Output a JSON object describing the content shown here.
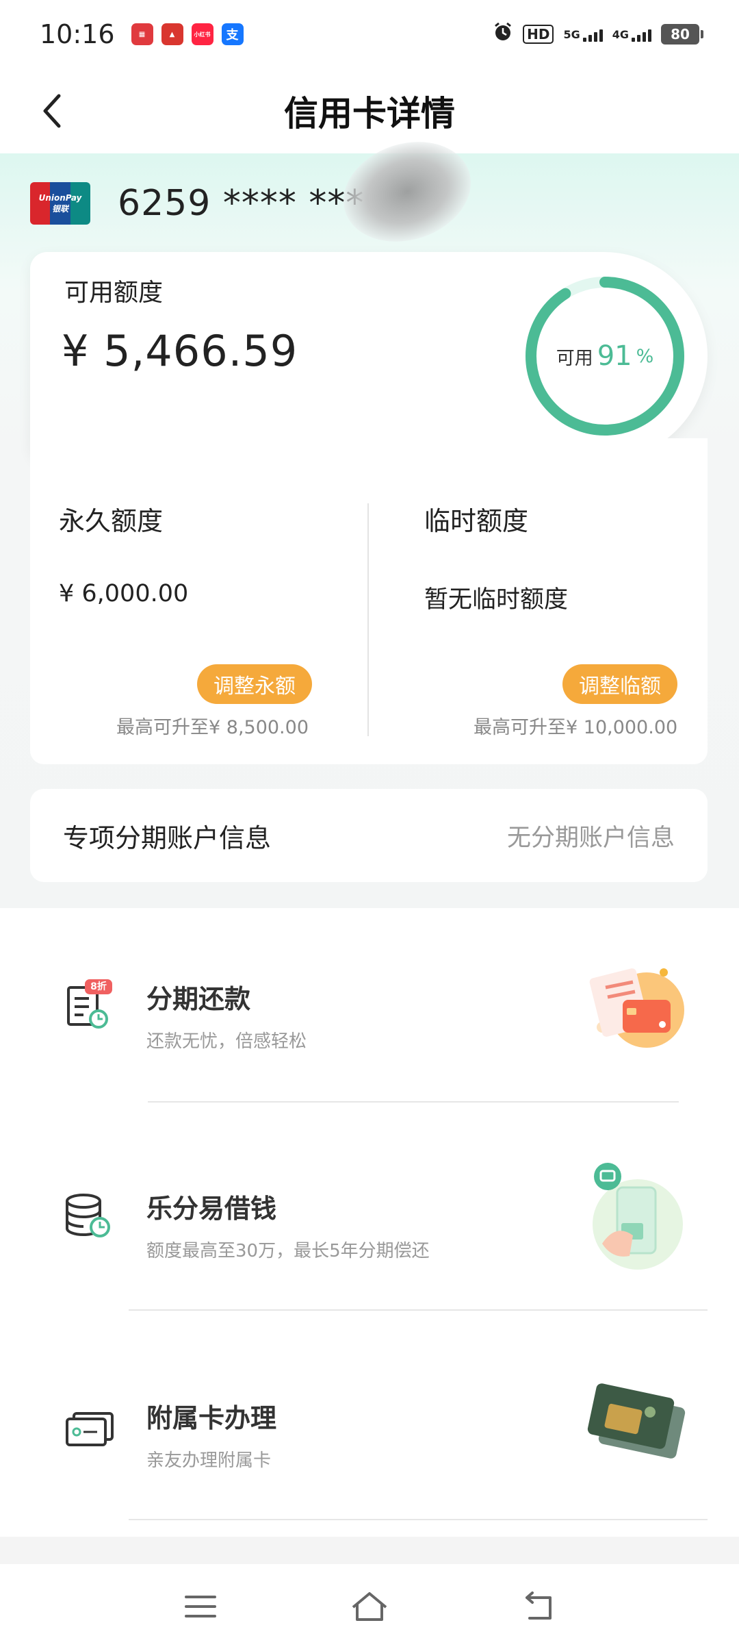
{
  "status_bar": {
    "time": "10:16",
    "app_icons": [
      {
        "name": "app-icon-red-1",
        "label": "",
        "color": "#e03a3e"
      },
      {
        "name": "app-icon-red-2",
        "label": "",
        "color": "#d9362f"
      },
      {
        "name": "app-icon-xiaohongshu",
        "label": "小红书",
        "color": "#ff2442"
      },
      {
        "name": "app-icon-alipay",
        "label": "支",
        "color": "#1677ff"
      }
    ],
    "hd_label": "HD",
    "network_5g": "5G",
    "network_4g": "4G",
    "battery": "80"
  },
  "header": {
    "title": "信用卡详情"
  },
  "card": {
    "logo_text_top": "UnionPay",
    "logo_text_bottom": "银联",
    "number_masked": "6259 **** ***"
  },
  "available": {
    "label": "可用额度",
    "amount": "¥ 5,466.59",
    "ring_label": "可用",
    "ring_percent": "91",
    "ring_unit": "%",
    "ring_fraction": 0.91,
    "ring_color": "#4cbb95",
    "ring_track_color": "#e3f7f0"
  },
  "limits": {
    "permanent": {
      "title": "永久额度",
      "value": "¥ 6,000.00",
      "button": "调整永额",
      "max_note": "最高可升至¥ 8,500.00"
    },
    "temporary": {
      "title": "临时额度",
      "value": "暂无临时额度",
      "button": "调整临额",
      "max_note": "最高可升至¥ 10,000.00"
    },
    "button_color": "#f5a93b"
  },
  "installment_account": {
    "label": "专项分期账户信息",
    "value": "无分期账户信息"
  },
  "services": [
    {
      "title": "分期还款",
      "subtitle": "还款无忧，倍感轻松",
      "badge": "8折"
    },
    {
      "title": "乐分易借钱",
      "subtitle": "额度最高至30万，最长5年分期偿还"
    },
    {
      "title": "附属卡办理",
      "subtitle": "亲友办理附属卡"
    }
  ],
  "nav": {
    "menu_icon": "menu-icon",
    "home_icon": "home-icon",
    "back_icon": "back-icon"
  }
}
